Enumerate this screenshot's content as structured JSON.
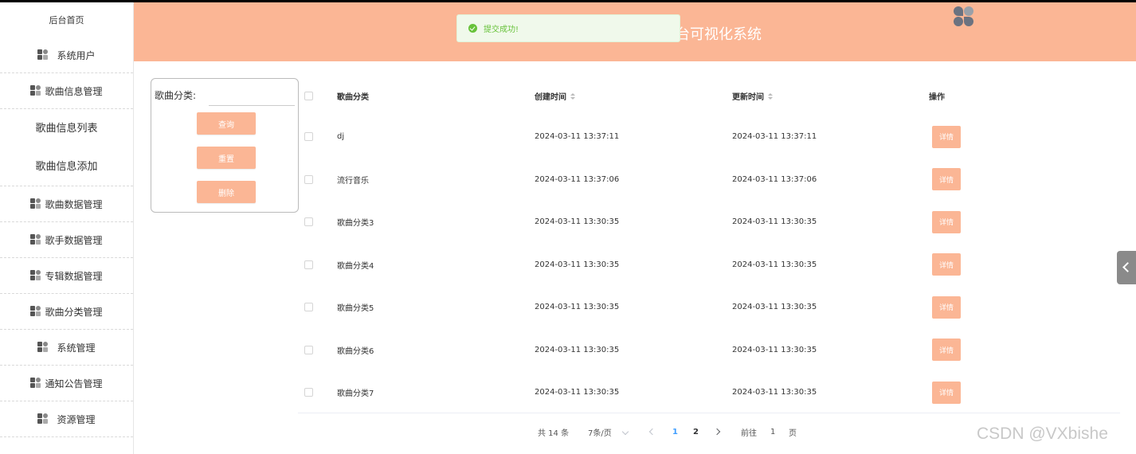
{
  "toast": {
    "message": "提交成功!"
  },
  "header": {
    "title": "台可视化系统"
  },
  "sidebar": {
    "home": "后台首页",
    "items": [
      {
        "label": "系统用户"
      },
      {
        "label": "歌曲信息管理"
      },
      {
        "label": "歌曲数据管理"
      },
      {
        "label": "歌手数据管理"
      },
      {
        "label": "专辑数据管理"
      },
      {
        "label": "歌曲分类管理"
      },
      {
        "label": "系统管理"
      },
      {
        "label": "通知公告管理"
      },
      {
        "label": "资源管理"
      }
    ],
    "sub_items": [
      {
        "label": "歌曲信息列表"
      },
      {
        "label": "歌曲信息添加"
      }
    ]
  },
  "search": {
    "label": "歌曲分类:",
    "value": "",
    "query_label": "查询",
    "reset_label": "重置",
    "delete_label": "删除"
  },
  "table": {
    "columns": [
      "歌曲分类",
      "创建时间",
      "更新时间",
      "操作"
    ],
    "detail_label": "详情",
    "rows": [
      {
        "category": "dj",
        "created": "2024-03-11 13:37:11",
        "updated": "2024-03-11 13:37:11"
      },
      {
        "category": "流行音乐",
        "created": "2024-03-11 13:37:06",
        "updated": "2024-03-11 13:37:06"
      },
      {
        "category": "歌曲分类3",
        "created": "2024-03-11 13:30:35",
        "updated": "2024-03-11 13:30:35"
      },
      {
        "category": "歌曲分类4",
        "created": "2024-03-11 13:30:35",
        "updated": "2024-03-11 13:30:35"
      },
      {
        "category": "歌曲分类5",
        "created": "2024-03-11 13:30:35",
        "updated": "2024-03-11 13:30:35"
      },
      {
        "category": "歌曲分类6",
        "created": "2024-03-11 13:30:35",
        "updated": "2024-03-11 13:30:35"
      },
      {
        "category": "歌曲分类7",
        "created": "2024-03-11 13:30:35",
        "updated": "2024-03-11 13:30:35"
      }
    ]
  },
  "pagination": {
    "total": "共 14 条",
    "page_size": "7条/页",
    "pages": [
      "1",
      "2"
    ],
    "current": "1",
    "goto_label": "前往",
    "goto_value": "1",
    "page_suffix": "页"
  },
  "watermark": "CSDN @VXbishe",
  "colors": {
    "accent": "#fbb695",
    "success": "#67c23a",
    "link": "#409eff"
  }
}
